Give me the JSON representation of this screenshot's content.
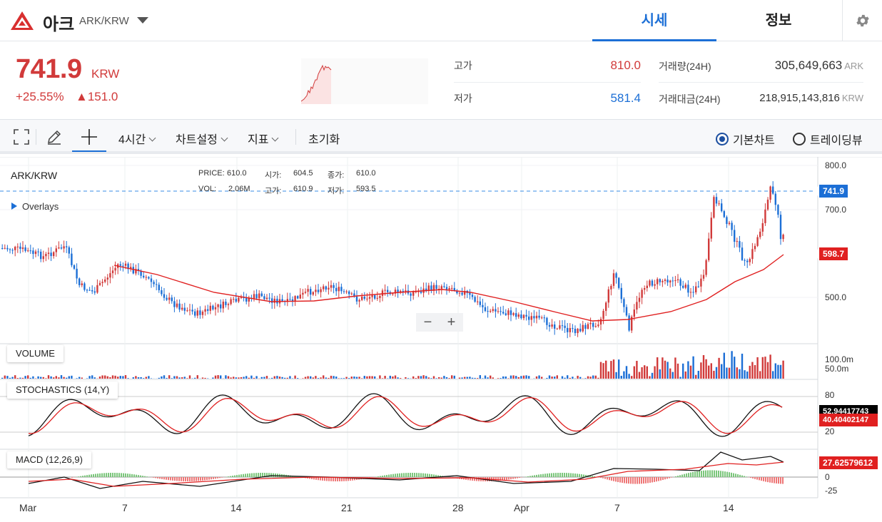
{
  "header": {
    "coin_name": "아크",
    "pair": "ARK/KRW",
    "tabs": [
      "시세",
      "정보"
    ]
  },
  "summary": {
    "price": "741.9",
    "unit": "KRW",
    "change_pct": "+25.55%",
    "change_abs": "▲151.0",
    "high_label": "고가",
    "high_value": "810.0",
    "low_label": "저가",
    "low_value": "581.4",
    "volume_label": "거래량(24H)",
    "volume_value": "305,649,663",
    "volume_unit": "ARK",
    "amount_label": "거래대금(24H)",
    "amount_value": "218,915,143,816",
    "amount_unit": "KRW"
  },
  "toolbar": {
    "interval": "4시간",
    "chart_settings": "차트설정",
    "indicators": "지표",
    "reset": "초기화",
    "basic_chart": "기본차트",
    "trading_view": "트레이딩뷰"
  },
  "chart": {
    "pair_label": "ARK/KRW",
    "price_label": "PRICE:",
    "price_value": "610.0",
    "open_label": "시가:",
    "open_value": "604.5",
    "close_label": "종가:",
    "close_value": "610.0",
    "vol_label": "VOL:",
    "vol_value": "2.06M",
    "high_label": "고가:",
    "high_value": "610.9",
    "low_label": "저가:",
    "low_value": "593.5",
    "overlays": "Overlays",
    "volume_pane": "VOLUME",
    "stoch_pane": "STOCHASTICS (14,Y)",
    "macd_pane": "MACD (12,26,9)",
    "price_ticks": [
      "800.0",
      "700.0",
      "500.0"
    ],
    "volume_ticks": [
      "100.0m",
      "50.0m"
    ],
    "stoch_ticks": [
      "80",
      "20"
    ],
    "macd_ticks": [
      "0",
      "-25"
    ],
    "tag_current": "741.9",
    "tag_ma": "598.7",
    "tag_stoch_k": "52.94417743",
    "tag_stoch_d": "40.40402147",
    "tag_macd": "27.62579612",
    "x_labels": [
      "Mar",
      "7",
      "14",
      "21",
      "28",
      "Apr",
      "7",
      "14"
    ]
  },
  "colors": {
    "accent": "#1c6fd6",
    "up": "#d13a3a",
    "down": "#1c6fd6",
    "ma": "#e02020"
  }
}
